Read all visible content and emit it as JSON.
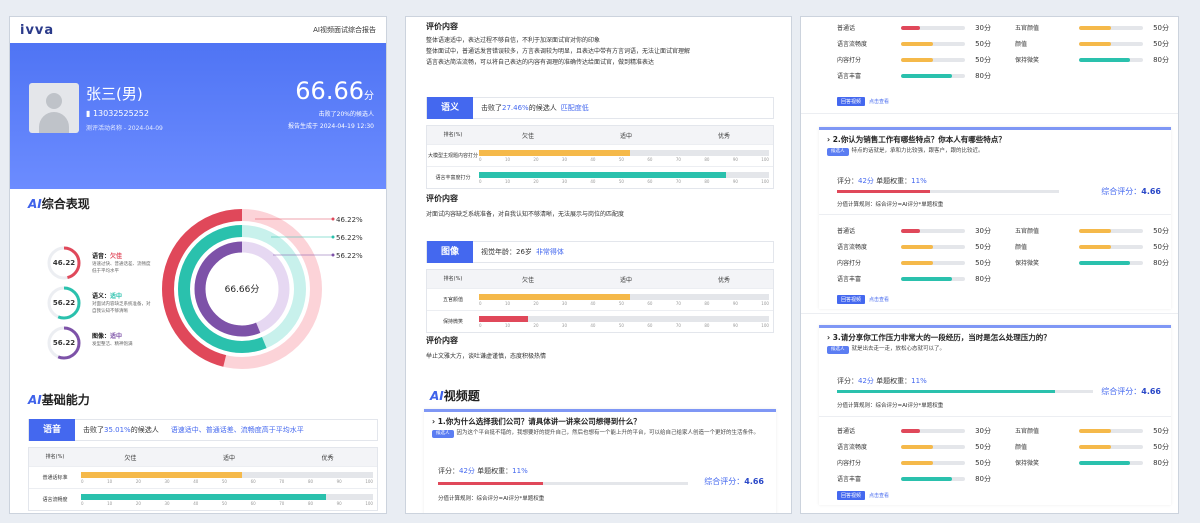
{
  "header": {
    "logo": "ivva",
    "report_title": "AI视频面试综合报告",
    "name": "张三(男)",
    "phone": "13032525252",
    "activity": "测评活动名称 - 2024-04-09",
    "score": "66.66",
    "score_unit": "分",
    "beat": "击败了20%的候选人",
    "generated": "报告生成于 2024-04-19 12:30"
  },
  "overview": {
    "title_ai": "AI",
    "title_rest": "综合表现",
    "items": [
      {
        "score": "46.22",
        "name": "语音：",
        "level": "欠佳",
        "desc": "语速过快、普通话差、流畅度低于平均水平",
        "color": "#e0485a",
        "pct": 0.4622
      },
      {
        "score": "56.22",
        "name": "语义：",
        "level": "适中",
        "desc": "对面试内容缺乏系统准备，对自我认知不够清晰",
        "color": "#2ac1ad",
        "pct": 0.5622
      },
      {
        "score": "56.22",
        "name": "图像：",
        "level": "适中",
        "desc": "发型整洁、精神饱满",
        "color": "#7d52a8",
        "pct": 0.5622
      }
    ],
    "center": "66.66分",
    "legend": [
      "46.22%",
      "56.22%",
      "56.22%"
    ]
  },
  "basic": {
    "title_ai": "AI",
    "title_rest": "基础能力"
  },
  "ticks": [
    "0",
    "10",
    "20",
    "30",
    "40",
    "50",
    "60",
    "70",
    "80",
    "90",
    "100"
  ],
  "levels": [
    "排名(%)",
    "欠佳",
    "适中",
    "优秀"
  ],
  "voice": {
    "tag": "语音",
    "beat_pre": "击败了",
    "beat_pct": "35.01%",
    "beat_post": "的候选人",
    "note": "语速适中、普通话差、流畅度高于平均水平",
    "rows": [
      {
        "label": "普通话标准",
        "value": 55,
        "color": "#f5b94a"
      },
      {
        "label": "语言流畅度",
        "value": 84,
        "color": "#2ac1ad"
      }
    ]
  },
  "p2": {
    "eval1_title": "评价内容",
    "eval1_lines": [
      "整体语速适中，表达过程不够自信，不利于加深面试官对你的印象",
      "整体面试中，普通话发音错误较多，方言表调较为明显，且表达中带有方言词语，无法让面试官理解",
      "语言表达简洁流畅，可以将自己表达的内容有调理的准确传达给面试官，做到精准表达"
    ],
    "semantic": {
      "tag": "语义",
      "beat_pre": "击败了",
      "beat_pct": "27.46%",
      "beat_post": "的候选人",
      "note": "匹配度低",
      "rows": [
        {
          "label": "大模型主观题内容打分",
          "value": 52,
          "color": "#f5b94a"
        },
        {
          "label": "语言丰富度打分",
          "value": 85,
          "color": "#2ac1ad"
        }
      ]
    },
    "eval2_title": "评价内容",
    "eval2_text": "对面试内容缺乏系统准备，对自我认知不够清晰，无法展示与岗位的匹配度",
    "image": {
      "tag": "图像",
      "beat_text": "视觉年龄：26岁",
      "note": "非常得体",
      "rows": [
        {
          "label": "五官颜值",
          "value": 52,
          "color": "#f5b94a"
        },
        {
          "label": "保持微笑",
          "value": 17,
          "color": "#e0485a"
        }
      ]
    },
    "eval3_title": "评价内容",
    "eval3_text": "举止文雅大方，谈吐谦虚谨慎，态度积极热情",
    "video_title_ai": "AI",
    "video_title_rest": "视频题",
    "q1": {
      "title": "1.你为什么选择我们公司？请具体讲一讲来公司想得到什么？",
      "cand": "候选人",
      "answer": "因为这个平台挺不错的，我想要好的提升自己，然后也想有一个能上升的平台，可以给自己给家人创造一个更好的生活条件。",
      "score_pre": "评分：",
      "score": "42分",
      "weight_pre": "单题权重：",
      "weight": "11%",
      "overall_pre": "综合评分：",
      "overall": "4.66",
      "rule": "分值计算规则：综合评分=AI评分*单题权重",
      "progress": 0.42
    }
  },
  "p3": {
    "top_skills_left": [
      {
        "name": "普通话",
        "value": "30分",
        "color": "#e0485a",
        "pct": 0.3
      },
      {
        "name": "语言流畅度",
        "value": "50分",
        "color": "#f5b94a",
        "pct": 0.5
      },
      {
        "name": "内容打分",
        "value": "50分",
        "color": "#f5b94a",
        "pct": 0.5
      },
      {
        "name": "语言丰富",
        "value": "80分",
        "color": "#2ac1ad",
        "pct": 0.8
      }
    ],
    "top_skills_right": [
      {
        "name": "五官颜值",
        "value": "50分",
        "color": "#f5b94a",
        "pct": 0.5
      },
      {
        "name": "颜值",
        "value": "50分",
        "color": "#f5b94a",
        "pct": 0.5
      },
      {
        "name": "保持微笑",
        "value": "80分",
        "color": "#2ac1ad",
        "pct": 0.8
      }
    ],
    "video_btn": "回答视频",
    "video_link": "点击查看",
    "q2": {
      "title": "2.你认为销售工作有哪些特点？你本人有哪些特点？",
      "cand": "候选人",
      "answer": "特点的话就是，承和力比较强，跟客户，跟的比较近。",
      "score_pre": "评分：",
      "score": "42分",
      "weight_pre": "单题权重：",
      "weight": "11%",
      "overall_pre": "综合评分：",
      "overall": "4.66",
      "rule": "分值计算规则：综合评分=AI评分*单题权重",
      "progress": 0.42
    },
    "q3": {
      "title": "3.请分享你工作压力非常大的一段经历，当时是怎么处理压力的？",
      "cand": "候选人",
      "answer": "就是出去走一走，放松心态就可以了。",
      "score_pre": "评分：",
      "score": "42分",
      "weight_pre": "单题权重：",
      "weight": "11%",
      "overall_pre": "综合评分：",
      "overall": "4.66",
      "rule": "分值计算规则：综合评分=AI评分*单题权重",
      "progress": 0.85
    }
  },
  "colors": {
    "accent": "#4468ef",
    "red": "#e0485a",
    "orange": "#f5b94a",
    "teal": "#2ac1ad",
    "purple": "#7d52a8"
  }
}
